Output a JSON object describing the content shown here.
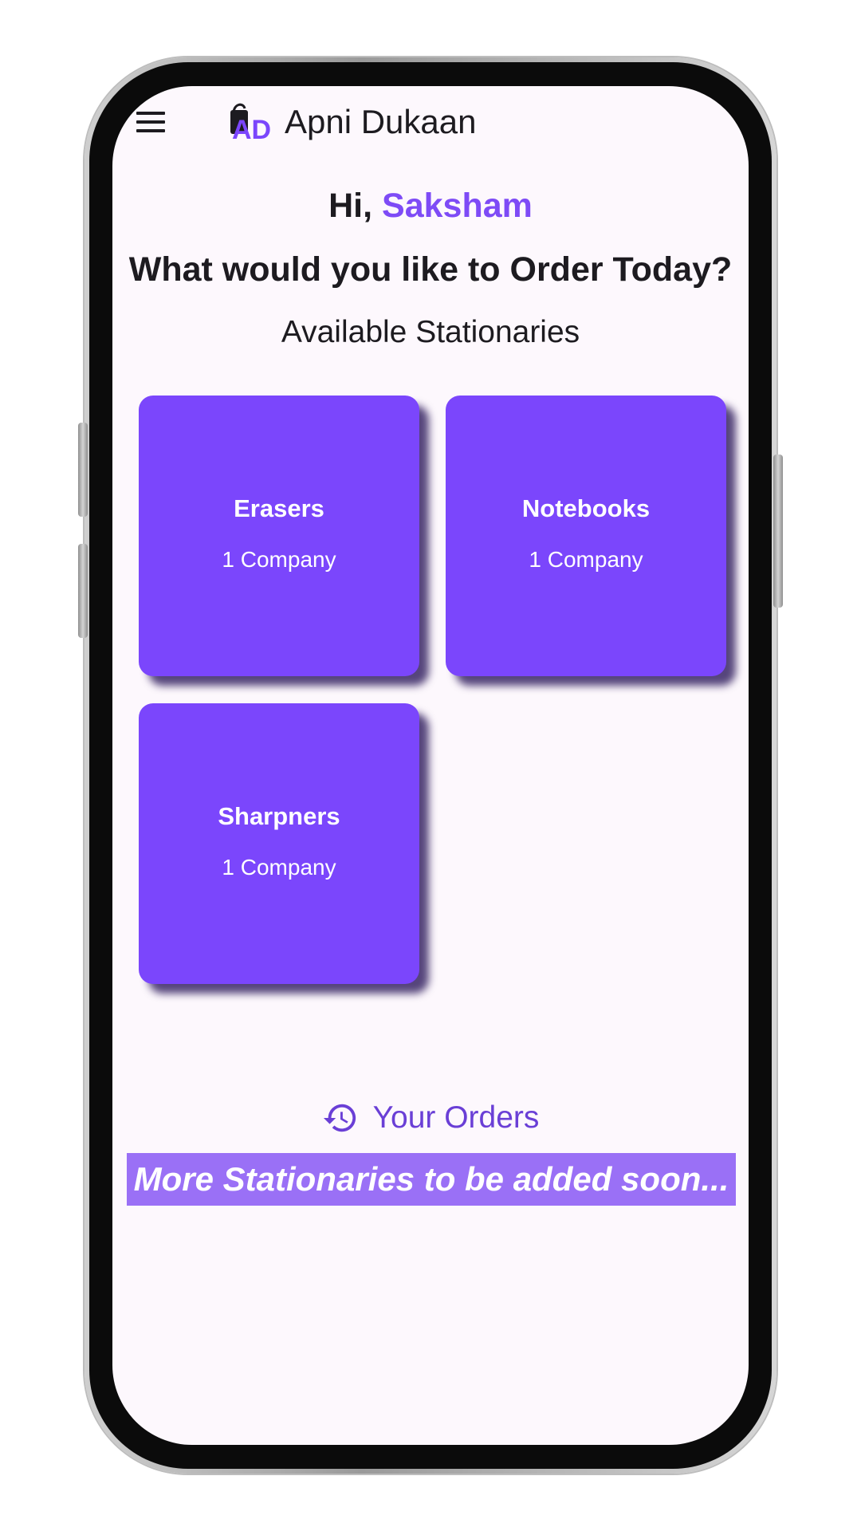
{
  "app": {
    "title": "Apni Dukaan",
    "logo_text": "AD",
    "menu_icon": "hamburger-menu-icon",
    "accent_color": "#7b46fc"
  },
  "greeting": {
    "prefix": "Hi,",
    "name": "Saksham"
  },
  "question": "What would you like to Order Today?",
  "section_title": "Available Stationaries",
  "categories": [
    {
      "title": "Erasers",
      "subtitle": "1 Company"
    },
    {
      "title": "Notebooks",
      "subtitle": "1 Company"
    },
    {
      "title": "Sharpners",
      "subtitle": "1 Company"
    }
  ],
  "orders": {
    "icon": "history-icon",
    "label": "Your Orders"
  },
  "banner": "More Stationaries to be added soon..."
}
